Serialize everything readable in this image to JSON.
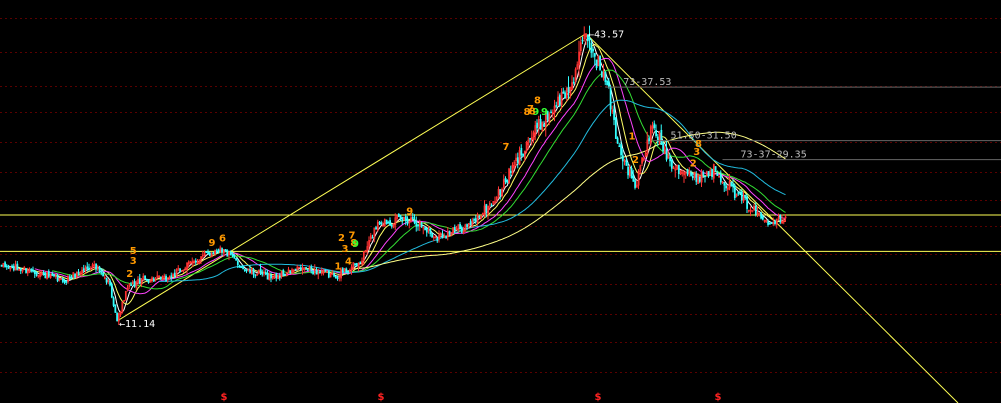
{
  "chart_data": {
    "type": "candlestick",
    "grid": true,
    "background": "#000000",
    "colors": {
      "up": "#ff3333",
      "down": "#33ffff",
      "ma_fast": "#ffffff",
      "ma_mid": "#ffff66",
      "ma_slow": "#ff44ff",
      "ma_green": "#33dd33",
      "ma_cyan": "#22bbdd",
      "ma_long": "#ffff88",
      "trendline": "#ffff55",
      "count_orange": "#ff9900",
      "count_green": "#33ff33",
      "marker_red": "#ff2222",
      "level_text": "#bbbbbb"
    },
    "extremes": [
      {
        "label": "11.14",
        "value": 11.14
      },
      {
        "label": "43.57",
        "value": 43.57
      }
    ],
    "levels": [
      {
        "label": "73-37.53",
        "value": 37.53
      },
      {
        "label": "51.50-31.50",
        "value": 31.5
      },
      {
        "label": "73-37-29.35",
        "value": 29.35
      }
    ],
    "support_lines": [
      {
        "value": 23.1,
        "label": ""
      },
      {
        "value": 19.0,
        "label": ""
      }
    ],
    "bottom_markers": [
      "$",
      "$",
      "$",
      "$"
    ],
    "count_labels": [
      "9",
      "8",
      "7",
      "4",
      "3",
      "2",
      "1",
      "8",
      "7",
      "2",
      "3",
      "5",
      "6",
      "9",
      "8",
      "9",
      "2",
      "1",
      "9",
      "8",
      "7",
      "2",
      "3",
      "8",
      "9"
    ],
    "path_points": [
      {
        "i": 0,
        "p": 17.3
      },
      {
        "i": 18,
        "p": 16.8
      },
      {
        "i": 35,
        "p": 15.6
      },
      {
        "i": 52,
        "p": 17.5
      },
      {
        "i": 62,
        "p": 15.2
      },
      {
        "i": 66,
        "p": 11.14
      },
      {
        "i": 72,
        "p": 14.9
      },
      {
        "i": 80,
        "p": 15.8
      },
      {
        "i": 95,
        "p": 15.9
      },
      {
        "i": 110,
        "p": 17.9
      },
      {
        "i": 125,
        "p": 19.4
      },
      {
        "i": 140,
        "p": 16.8
      },
      {
        "i": 155,
        "p": 16.1
      },
      {
        "i": 172,
        "p": 17.1
      },
      {
        "i": 190,
        "p": 16.2
      },
      {
        "i": 205,
        "p": 17.7
      },
      {
        "i": 215,
        "p": 22.3
      },
      {
        "i": 235,
        "p": 22.7
      },
      {
        "i": 248,
        "p": 20.6
      },
      {
        "i": 268,
        "p": 22.0
      },
      {
        "i": 283,
        "p": 25.1
      },
      {
        "i": 300,
        "p": 31.3
      },
      {
        "i": 316,
        "p": 35.4
      },
      {
        "i": 325,
        "p": 37.5
      },
      {
        "i": 334,
        "p": 43.57
      },
      {
        "i": 346,
        "p": 37.8
      },
      {
        "i": 352,
        "p": 31.2
      },
      {
        "i": 362,
        "p": 26.2
      },
      {
        "i": 372,
        "p": 33.2
      },
      {
        "i": 382,
        "p": 29.2
      },
      {
        "i": 395,
        "p": 27.3
      },
      {
        "i": 408,
        "p": 28.2
      },
      {
        "i": 420,
        "p": 25.4
      },
      {
        "i": 436,
        "p": 22.5
      },
      {
        "i": 448,
        "p": 22.9
      }
    ],
    "bar_count": 449
  }
}
